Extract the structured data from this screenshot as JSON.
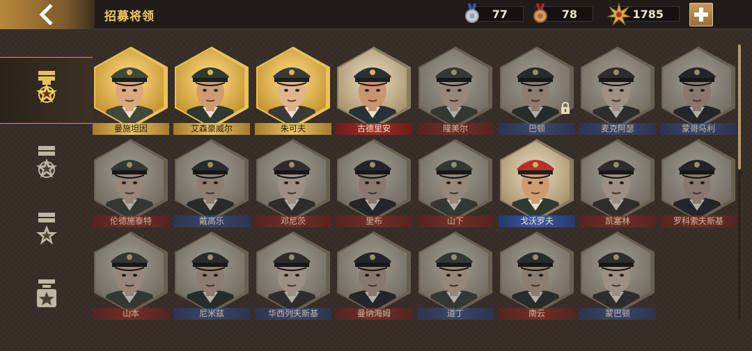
{
  "header": {
    "title": "招募将领",
    "resources": [
      {
        "icon": "silver-medal-icon",
        "value": "77"
      },
      {
        "icon": "bronze-medal-icon",
        "value": "78"
      },
      {
        "icon": "gold-star-badge-icon",
        "value": "1785"
      }
    ]
  },
  "sidebar": {
    "tabs": [
      {
        "icon": "rank-five-star-icon",
        "active": true
      },
      {
        "icon": "rank-three-star-icon",
        "active": false
      },
      {
        "icon": "rank-two-star-icon",
        "active": false
      },
      {
        "icon": "rank-one-star-icon",
        "active": false
      }
    ]
  },
  "generals": [
    {
      "name": "曼施坦因",
      "tier": "gold",
      "faction": "gold"
    },
    {
      "name": "艾森豪威尔",
      "tier": "gold",
      "faction": "gold"
    },
    {
      "name": "朱可夫",
      "tier": "gold",
      "faction": "gold"
    },
    {
      "name": "古德里安",
      "tier": "full",
      "faction": "red"
    },
    {
      "name": "隆美尔",
      "tier": "dim",
      "faction": "red"
    },
    {
      "name": "巴顿",
      "tier": "dim",
      "faction": "blue",
      "locked": true
    },
    {
      "name": "麦克阿瑟",
      "tier": "dim",
      "faction": "blue"
    },
    {
      "name": "蒙哥马利",
      "tier": "dim",
      "faction": "blue"
    },
    {
      "name": "伦德施泰特",
      "tier": "dim",
      "faction": "red"
    },
    {
      "name": "戴高乐",
      "tier": "dim",
      "faction": "blue"
    },
    {
      "name": "邓尼茨",
      "tier": "dim",
      "faction": "red"
    },
    {
      "name": "里布",
      "tier": "dim",
      "faction": "red"
    },
    {
      "name": "山下",
      "tier": "dim",
      "faction": "red"
    },
    {
      "name": "戈沃罗夫",
      "tier": "full",
      "faction": "blue"
    },
    {
      "name": "凯塞林",
      "tier": "dim",
      "faction": "red"
    },
    {
      "name": "罗科索夫斯基",
      "tier": "dim",
      "faction": "red"
    },
    {
      "name": "山本",
      "tier": "dim",
      "faction": "red"
    },
    {
      "name": "尼米兹",
      "tier": "dim",
      "faction": "blue"
    },
    {
      "name": "华西列夫斯基",
      "tier": "dim",
      "faction": "blue"
    },
    {
      "name": "曼纳海姆",
      "tier": "dim",
      "faction": "red"
    },
    {
      "name": "道丁",
      "tier": "dim",
      "faction": "blue"
    },
    {
      "name": "南云",
      "tier": "dim",
      "faction": "red"
    },
    {
      "name": "蒙巴顿",
      "tier": "dim",
      "faction": "blue"
    }
  ]
}
